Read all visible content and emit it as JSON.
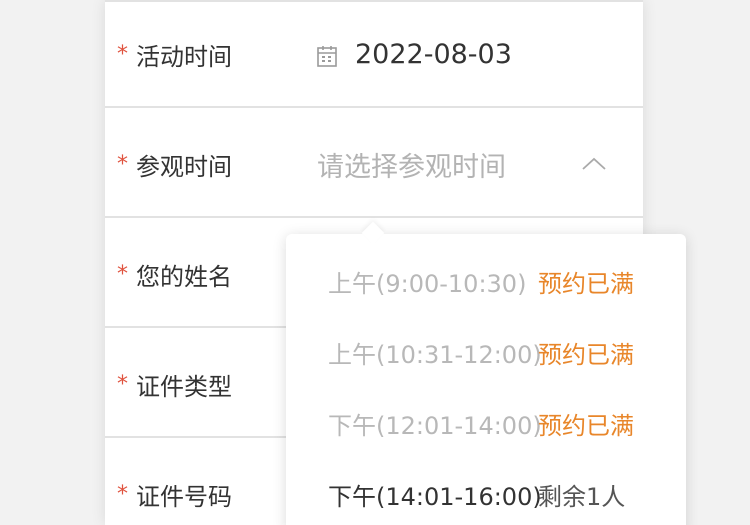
{
  "form": {
    "rows": [
      {
        "required": "*",
        "label": "活动时间",
        "value": "2022-08-03"
      },
      {
        "required": "*",
        "label": "参观时间",
        "placeholder": "请选择参观时间"
      },
      {
        "required": "*",
        "label": "您的姓名"
      },
      {
        "required": "*",
        "label": "证件类型"
      },
      {
        "required": "*",
        "label": "证件号码"
      }
    ]
  },
  "dropdown": {
    "options": [
      {
        "time": "上午(9:00-10:30)",
        "status": "预约已满",
        "state": "disabled"
      },
      {
        "time": "上午(10:31-12:00)",
        "status": "预约已满",
        "state": "disabled"
      },
      {
        "time": "下午(12:01-14:00)",
        "status": "预约已满",
        "state": "disabled"
      },
      {
        "time": "下午(14:01-16:00)",
        "status": "剩余1人",
        "state": "available"
      }
    ]
  },
  "colors": {
    "required": "#e0533f",
    "full_status": "#e8862a",
    "placeholder": "#b3b3b3",
    "disabled_option": "#b8b8b8"
  },
  "icons": {
    "date": "calendar-icon",
    "toggle": "chevron-up-icon"
  }
}
